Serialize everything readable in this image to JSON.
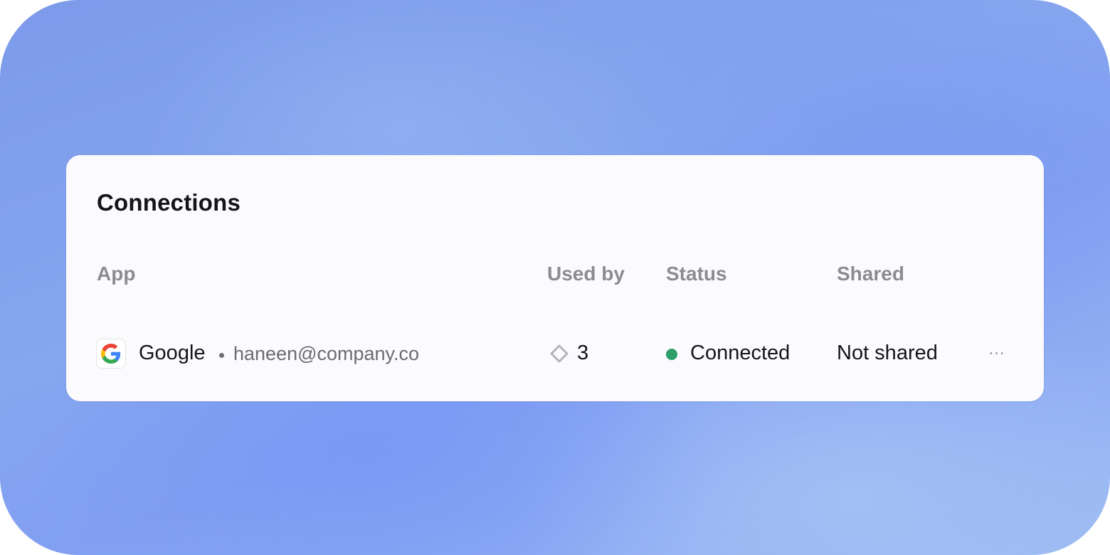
{
  "panel": {
    "title": "Connections"
  },
  "table": {
    "columns": [
      "App",
      "Used by",
      "Status",
      "Shared"
    ],
    "rows": [
      {
        "app_name": "Google",
        "app_icon": "google-icon",
        "account": "haneen@company.co",
        "used_by_icon": "diamond-link-icon",
        "used_by": "3",
        "status": "Connected",
        "status_color": "#2e9e6b",
        "shared": "Not shared",
        "more_label": "···"
      }
    ]
  },
  "colors": {
    "card_bg": "#fbfafd",
    "text_primary": "#151518",
    "text_muted": "#8c8b92"
  }
}
